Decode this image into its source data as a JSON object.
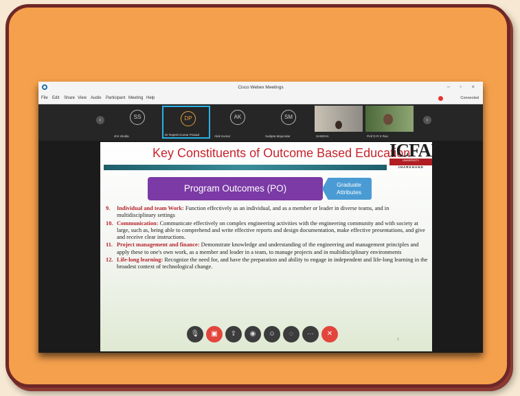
{
  "window": {
    "title": "Cisco Webex Meetings",
    "controls": "–  ▫  ×",
    "status": "Connected"
  },
  "menu": [
    "File",
    "Edit",
    "Share",
    "View",
    "Audio",
    "Participant",
    "Meeting",
    "Help"
  ],
  "participants": [
    {
      "initials": "SS",
      "name": "shri shukla"
    },
    {
      "initials": "DP",
      "name": "Dr Rajesh Kumar Prasad"
    },
    {
      "initials": "AK",
      "name": "Alok Kumar"
    },
    {
      "initials": "SM",
      "name": "Sudipta Majumdar"
    },
    {
      "initials": "",
      "name": "SANDHA"
    },
    {
      "initials": "",
      "name": "Prof D R S Rao"
    }
  ],
  "slide": {
    "title": "Key Constituents of Outcome Based Education",
    "logo": {
      "brand": "ICFAI",
      "bar": "UNIVERSITY",
      "sub": "JHARKHAND"
    },
    "po_box": "Program Outcomes (PO)",
    "graduate_attributes": "Graduate Attributes",
    "outcomes": [
      {
        "num": "9.",
        "head": "Individual and team Work:",
        "text": " Function effectively as an individual, and as a member or leader in diverse teams, and in multidisciplinary settings"
      },
      {
        "num": "10.",
        "head": "Communication:",
        "text": " Communicate effectively on complex engineering activities with the engineering community and with society at large, such as, being able to comprehend and write effective reports and design documentation, make effective presentations, and give and receive clear instructions."
      },
      {
        "num": "11.",
        "head": "Project management and finance:",
        "text": " Demonstrate knowledge and understanding of the engineering and management principles and apply these to one's own work, as a member and leader in a team, to manage projects and in multidisciplinary environments"
      },
      {
        "num": "12.",
        "head": "Life-long learning:",
        "text": " Recognize the need for, and have the preparation and ability to engage in independent and life-long learning in the broadest context of technological change."
      }
    ],
    "page_number": "9"
  },
  "colors": {
    "frame_bg": "#f5a04c",
    "frame_border": "#6e2727",
    "slide_title": "#c8232c",
    "po_box": "#7b3aa5",
    "graduate_attributes": "#4a9bd4",
    "end_call": "#e2453c"
  },
  "toolbar_icons": [
    "microphone-icon",
    "video-icon",
    "share-icon",
    "record-icon",
    "participants-icon",
    "chat-icon",
    "more-icon",
    "end-call-icon"
  ]
}
